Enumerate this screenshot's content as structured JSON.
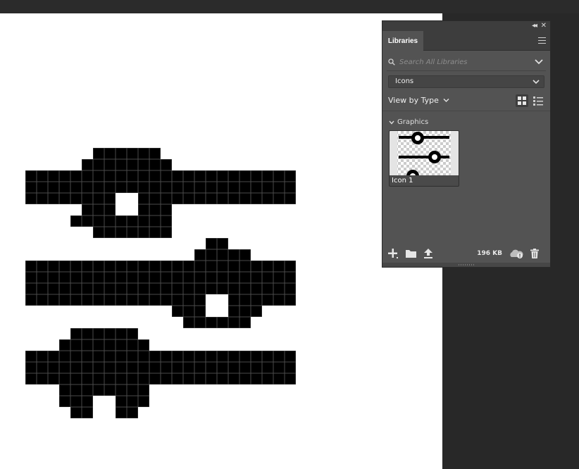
{
  "canvas": {
    "background": "#ffffff",
    "ink": "#000000",
    "grid_line": "#4a4a4a"
  },
  "libraries_panel": {
    "tab_label": "Libraries",
    "chrome_icons": [
      "collapse-icon",
      "close-icon",
      "panel-menu-icon"
    ],
    "search": {
      "placeholder": "Search All Libraries",
      "value": ""
    },
    "library_select": {
      "value": "Icons"
    },
    "view_by_label": "View by Type",
    "view_modes": [
      "grid-view-icon",
      "list-view-icon"
    ],
    "section": {
      "label": "Graphics",
      "assets": [
        {
          "label": "Icon 1"
        }
      ]
    },
    "footer": {
      "storage": "196 KB",
      "icons": [
        "add-icon",
        "folder-icon",
        "upload-icon",
        "cloud-sync-icon",
        "trash-icon"
      ]
    }
  },
  "colors": {
    "panel_bg": "#535353",
    "panel_dark": "#3d3d3d",
    "app_bg": "#282828",
    "text": "#e6e6e6"
  }
}
